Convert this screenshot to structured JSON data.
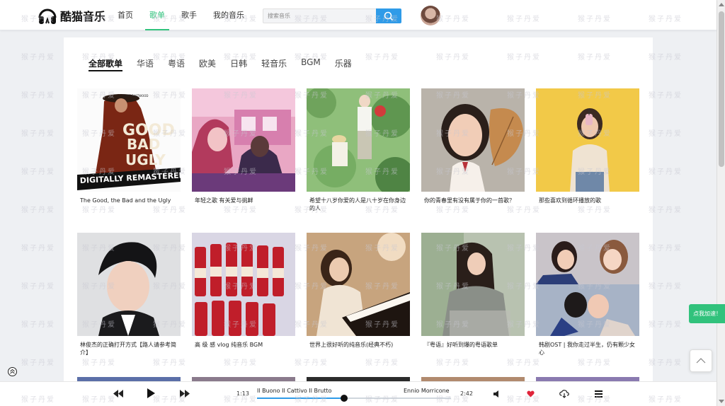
{
  "header": {
    "logo_text": "酷猫音乐",
    "nav": [
      "首页",
      "歌单",
      "歌手",
      "我的音乐"
    ],
    "nav_active_index": 1,
    "search_placeholder": "搜索音乐",
    "accent_color": "#31c27c",
    "search_button_color": "#2f9be8"
  },
  "watermark_text": "猴子丹爱",
  "tabs": [
    "全部歌单",
    "华语",
    "粤语",
    "欧美",
    "日韩",
    "轻音乐",
    "BGM",
    "乐器"
  ],
  "tabs_active_index": 0,
  "playlists": [
    {
      "title": "The Good, the Bad and the Ugly",
      "cover": "poster"
    },
    {
      "title": "年轻之歌 有关爱与挑衅",
      "cover": "illustration-couple"
    },
    {
      "title": "希望十八岁你爱的人是八十岁在你身边的人",
      "cover": "illustration-garden"
    },
    {
      "title": "你的青春里有没有属于你的一首歌？",
      "cover": "photo-girl-leaf"
    },
    {
      "title": "那些喜欢到循环播放的歌",
      "cover": "photo-girl-yellow"
    },
    {
      "title": "林俊杰的正确打开方式【路人请参考简介】",
      "cover": "photo-man"
    },
    {
      "title": "高 级 感 vlog 纯音乐 BGM",
      "cover": "photo-bottles"
    },
    {
      "title": "世界上很好听的纯音乐(经典不朽)",
      "cover": "photo-piano"
    },
    {
      "title": "『粤语』好听到爆的粤语歌单",
      "cover": "photo-girl-sweater"
    },
    {
      "title": "韩剧OST | 我你走过半生，仍有颗少女心",
      "cover": "photo-kdrama"
    }
  ],
  "poster_text": {
    "top": "CLINT EASTWOOD",
    "good": "GOOD",
    "bad": "BAD",
    "ugly": "UGLY",
    "banner": "DIGITALLY REMASTERED"
  },
  "float_button": "点我加速！",
  "player": {
    "current_time": "1:13",
    "total_time": "2:42",
    "song_title": "Il Buono Il Cattivo Il Brutto",
    "artist": "Ennio Morricone",
    "progress": 0.45,
    "liked": true,
    "like_color": "#e0243a"
  },
  "icons": {
    "prev": "prev-icon",
    "play": "play-icon",
    "next": "next-icon",
    "volume": "volume-icon",
    "heart": "heart-icon",
    "download": "download-icon",
    "playlist": "playlist-icon",
    "back_to_top": "chevron-up-icon"
  }
}
